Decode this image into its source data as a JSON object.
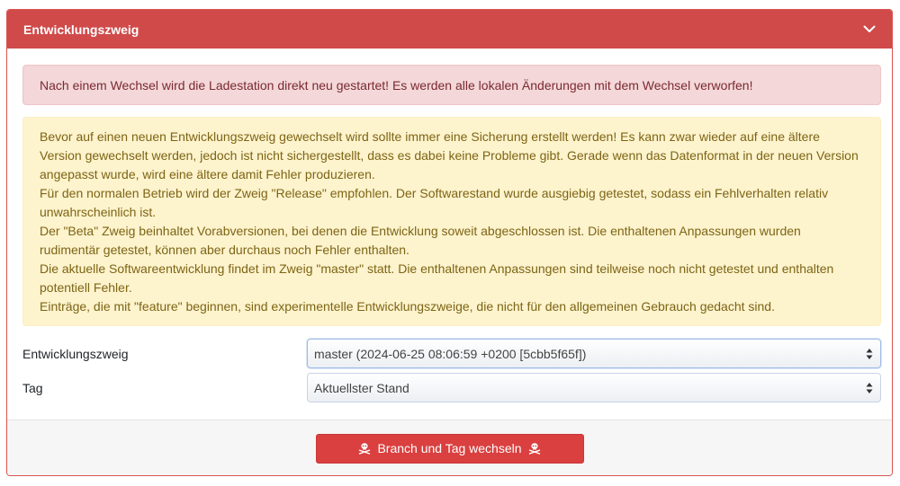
{
  "panel": {
    "title": "Entwicklungszweig",
    "collapse_icon": "chevron-down-icon"
  },
  "alerts": {
    "danger": "Nach einem Wechsel wird die Ladestation direkt neu gestartet! Es werden alle lokalen Änderungen mit dem Wechsel verworfen!",
    "warning": [
      "Bevor auf einen neuen Entwicklungszweig gewechselt wird sollte immer eine Sicherung erstellt werden! Es kann zwar wieder auf eine ältere Version gewechselt werden, jedoch ist nicht sichergestellt, dass es dabei keine Probleme gibt. Gerade wenn das Datenformat in der neuen Version angepasst wurde, wird eine ältere damit Fehler produzieren.",
      "Für den normalen Betrieb wird der Zweig \"Release\" empfohlen. Der Softwarestand wurde ausgiebig getestet, sodass ein Fehlverhalten relativ unwahrscheinlich ist.",
      "Der \"Beta\" Zweig beinhaltet Vorabversionen, bei denen die Entwicklung soweit abgeschlossen ist. Die enthaltenen Anpassungen wurden rudimentär getestet, können aber durchaus noch Fehler enthalten.",
      "Die aktuelle Softwareentwicklung findet im Zweig \"master\" statt. Die enthaltenen Anpassungen sind teilweise noch nicht getestet und enthalten potentiell Fehler.",
      "Einträge, die mit \"feature\" beginnen, sind experimentelle Entwicklungszweige, die nicht für den allgemeinen Gebrauch gedacht sind."
    ]
  },
  "form": {
    "branch_label": "Entwicklungszweig",
    "branch_value": "master (2024-06-25 08:06:59 +0200 [5cbb5f65f])",
    "tag_label": "Tag",
    "tag_value": "Aktuellster Stand"
  },
  "footer": {
    "button_label": "Branch und Tag wechseln",
    "button_icon": "skull-crossbones-icon"
  },
  "colors": {
    "header": "#d04a4a",
    "button": "#d9403f",
    "danger_bg": "#f3d7d9",
    "warning_bg": "#fdf3cd"
  }
}
